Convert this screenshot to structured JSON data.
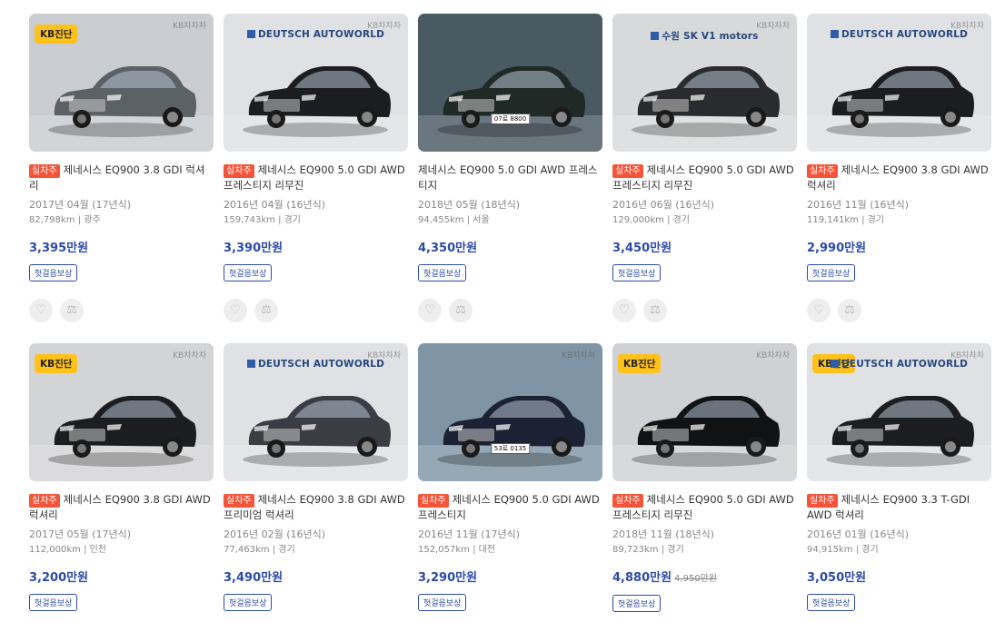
{
  "common": {
    "sale_tag": "실차주",
    "badge_label": "헛걸음보상",
    "kb_badge": "KB진단",
    "watermark": "KB차차차",
    "like_icon": "heart-icon",
    "compare_icon": "scale-icon"
  },
  "listings": [
    {
      "title": "제네시스 EQ900 3.8 GDI 럭셔리",
      "tag": true,
      "year": "2017년 04월 (17년식)",
      "km": "82,798km",
      "region": "광주",
      "price": "3,395만원",
      "orig_price": null,
      "kb": true,
      "dealer": null,
      "dealer_watermark": null,
      "plate": "",
      "color": "#5b6266",
      "bg": "#c9ccd0",
      "actions": true
    },
    {
      "title": "제네시스 EQ900 5.0 GDI AWD 프레스티지 리무진",
      "tag": true,
      "year": "2016년 04월 (16년식)",
      "km": "159,743km",
      "region": "경기",
      "price": "3,390만원",
      "orig_price": null,
      "kb": false,
      "dealer": "DEUTSCH AUTOWORLD",
      "dealer_watermark": null,
      "plate": "",
      "color": "#1c1d20",
      "bg": "#dfe1e4",
      "actions": true
    },
    {
      "title": "제네시스 EQ900 5.0 GDI AWD 프레스티지",
      "tag": false,
      "year": "2018년 05월 (18년식)",
      "km": "94,455km",
      "region": "서울",
      "price": "4,350만원",
      "orig_price": null,
      "kb": false,
      "dealer": null,
      "dealer_watermark": "KB차차차",
      "plate": "07로 8800",
      "color": "#1f2a26",
      "bg": "#4a5a63",
      "actions": true
    },
    {
      "title": "제네시스 EQ900 5.0 GDI AWD 프레스티지 리무진",
      "tag": true,
      "year": "2016년 06월 (16년식)",
      "km": "129,000km",
      "region": "경기",
      "price": "3,450만원",
      "orig_price": null,
      "kb": false,
      "dealer": "수원 SK V1 motors",
      "dealer_watermark": null,
      "plate": "",
      "color": "#2a2b2e",
      "bg": "#d8d9db",
      "actions": true
    },
    {
      "title": "제네시스 EQ900 3.8 GDI AWD 럭셔리",
      "tag": true,
      "year": "2016년 11월 (16년식)",
      "km": "119,141km",
      "region": "경기",
      "price": "2,990만원",
      "orig_price": null,
      "kb": false,
      "dealer": "DEUTSCH AUTOWORLD",
      "dealer_watermark": null,
      "plate": "",
      "color": "#1c1d20",
      "bg": "#dfe1e4",
      "actions": true
    },
    {
      "title": "제네시스 EQ900 3.8 GDI AWD 럭셔리",
      "tag": true,
      "year": "2017년 05월 (17년식)",
      "km": "112,000km",
      "region": "인천",
      "price": "3,200만원",
      "orig_price": null,
      "kb": true,
      "dealer": null,
      "dealer_watermark": null,
      "plate": "",
      "color": "#1c1d20",
      "bg": "#d3d4d6",
      "actions": false
    },
    {
      "title": "제네시스 EQ900 3.8 GDI AWD 프리미엄 럭셔리",
      "tag": true,
      "year": "2016년 02월 (16년식)",
      "km": "77,463km",
      "region": "경기",
      "price": "3,490만원",
      "orig_price": null,
      "kb": false,
      "dealer": "DEUTSCH AUTOWORLD",
      "dealer_watermark": null,
      "plate": "",
      "color": "#3a3d44",
      "bg": "#dfe1e4",
      "actions": false
    },
    {
      "title": "제네시스 EQ900 5.0 GDI AWD 프레스티지",
      "tag": true,
      "year": "2016년 11월 (17년식)",
      "km": "152,057km",
      "region": "대전",
      "price": "3,290만원",
      "orig_price": null,
      "kb": false,
      "dealer": null,
      "dealer_watermark": null,
      "plate": "53로 0135",
      "color": "#1b2233",
      "bg": "#7f95a6",
      "actions": false
    },
    {
      "title": "제네시스 EQ900 5.0 GDI AWD 프레스티지 리무진",
      "tag": true,
      "year": "2018년 11월 (18년식)",
      "km": "89,723km",
      "region": "경기",
      "price": "4,880만원",
      "orig_price": "4,950만원",
      "kb": true,
      "dealer": null,
      "dealer_watermark": null,
      "plate": "",
      "color": "#111214",
      "bg": "#cfd1d4",
      "actions": false
    },
    {
      "title": "제네시스 EQ900 3.3 T-GDI AWD 럭셔리",
      "tag": true,
      "year": "2016년 01월 (16년식)",
      "km": "94,915km",
      "region": "경기",
      "price": "3,050만원",
      "orig_price": null,
      "kb": true,
      "dealer": "DEUTSCH AUTOWORLD",
      "dealer_watermark": null,
      "plate": "",
      "color": "#1c1d20",
      "bg": "#dfe1e4",
      "actions": false
    }
  ]
}
